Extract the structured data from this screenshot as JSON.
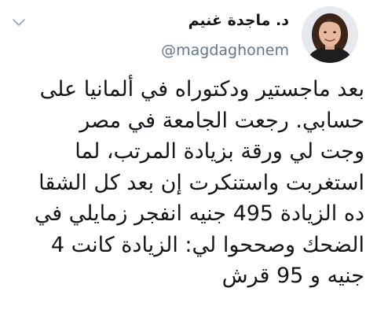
{
  "author": {
    "display_name": "د. ماجدة غنيم",
    "handle": "@magdaghonem"
  },
  "icons": {
    "menu": "chevron-down-icon",
    "avatar": "profile-photo"
  },
  "tweet": {
    "lines": [
      "بعد ماجستير ودكتوراه في ألمانيا على",
      "حسابي. رجعت الجامعة في مصر",
      "وجت لي ورقة بزيادة المرتب، لما",
      "استغربت واستنكرت إن بعد كل الشقا",
      "ده الزيادة 495 جنيه انفجر زمايلي في",
      "الضحك وصححوا لي: الزيادة كانت 4",
      "جنيه و 95 قرش"
    ]
  },
  "colors": {
    "text": "#14171a",
    "secondary": "#657786",
    "chevron": "#9aa6b2",
    "background": "#ffffff"
  }
}
